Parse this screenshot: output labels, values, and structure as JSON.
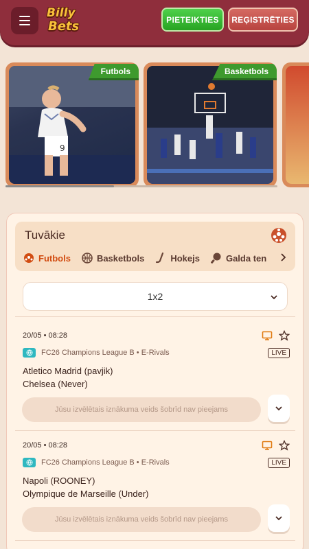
{
  "header": {
    "menu_icon": "hamburger-icon",
    "logo_line1": "Billy",
    "logo_line2": "Bets",
    "login_label": "PIETEIKTIES",
    "register_label": "REĢISTRĒTIES",
    "colors": {
      "header_bg": "#8f2e3c",
      "login": "#33b52e",
      "register": "#c65550"
    }
  },
  "banners": [
    {
      "tag": "Futbols",
      "image": "football-player-image"
    },
    {
      "tag": "Basketbols",
      "image": "basketball-game-image"
    },
    {
      "tag": "",
      "image": "partial-sport-image"
    }
  ],
  "upcoming": {
    "title": "Tuvākie",
    "tabs": [
      {
        "label": "Futbols",
        "icon": "soccer-ball-icon",
        "active": true
      },
      {
        "label": "Basketbols",
        "icon": "basketball-icon",
        "active": false
      },
      {
        "label": "Hokejs",
        "icon": "hockey-stick-icon",
        "active": false
      },
      {
        "label": "Galda ten",
        "icon": "table-tennis-icon",
        "active": false
      }
    ],
    "market_select": "1x2",
    "matches": [
      {
        "datetime": "20/05 • 08:28",
        "league": "FC26 Champions League B • E-Rivals",
        "status": "LIVE",
        "home": "Atletico Madrid (pavjik)",
        "away": "Chelsea (Never)",
        "unavailable": "Jūsu izvēlētais iznākuma veids šobrīd nav pieejams"
      },
      {
        "datetime": "20/05 • 08:28",
        "league": "FC26 Champions League B • E-Rivals",
        "status": "LIVE",
        "home": "Napoli (ROONEY)",
        "away": "Olympique de Marseille (Under)",
        "unavailable": "Jūsu izvēlētais iznākuma veids šobrīd nav pieejams"
      }
    ]
  }
}
